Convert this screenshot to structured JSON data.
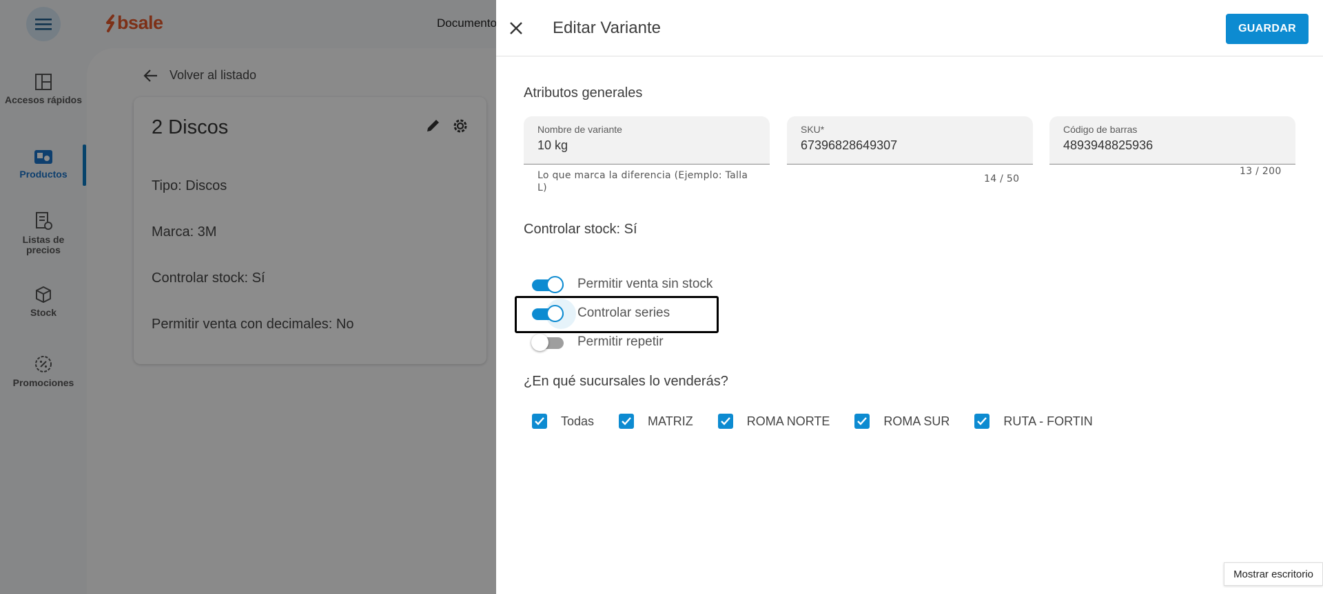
{
  "app": {
    "logo": "bsale",
    "top_title": "Documento",
    "rail": [
      {
        "label": "Accesos rápidos",
        "icon": "dashboard-icon"
      },
      {
        "label": "Productos",
        "icon": "products-icon",
        "active": true
      },
      {
        "label": "Listas de precios",
        "icon": "price-list-icon"
      },
      {
        "label": "Stock",
        "icon": "cube-icon"
      },
      {
        "label": "Promociones",
        "icon": "promo-badge-icon"
      }
    ],
    "back_label": "Volver al listado",
    "card": {
      "title": "2 Discos",
      "lines": [
        "Tipo: Discos",
        "Marca: 3M",
        "Controlar stock: Sí",
        "Permitir venta con decimales: No"
      ]
    }
  },
  "drawer": {
    "title": "Editar Variante",
    "save_label": "GUARDAR",
    "general_title": "Atributos generales",
    "fields": [
      {
        "label": "Nombre de variante",
        "value": "10 kg",
        "hint": "Lo que marca la diferencia (Ejemplo: Talla L)"
      },
      {
        "label": "SKU*",
        "value": "67396828649307",
        "counter": "14 / 50"
      },
      {
        "label": "Código de barras",
        "value": "4893948825936",
        "counter": "13 / 200"
      }
    ],
    "stock_title": "Controlar stock: Sí",
    "toggles": [
      {
        "label": "Permitir venta sin stock",
        "on": true
      },
      {
        "label": "Controlar series",
        "on": true
      },
      {
        "label": "Permitir repetir",
        "on": false
      }
    ],
    "branches_title": "¿En qué sucursales lo venderás?",
    "branches": [
      {
        "label": "Todas",
        "checked": true
      },
      {
        "label": "MATRIZ",
        "checked": true
      },
      {
        "label": "ROMA NORTE",
        "checked": true
      },
      {
        "label": "ROMA SUR",
        "checked": true
      },
      {
        "label": "RUTA - FORTIN",
        "checked": true
      }
    ]
  },
  "taskbar": {
    "show_desktop": "Mostrar escritorio"
  },
  "colors": {
    "accent": "#0d8bd1",
    "brand": "#e4582b"
  }
}
